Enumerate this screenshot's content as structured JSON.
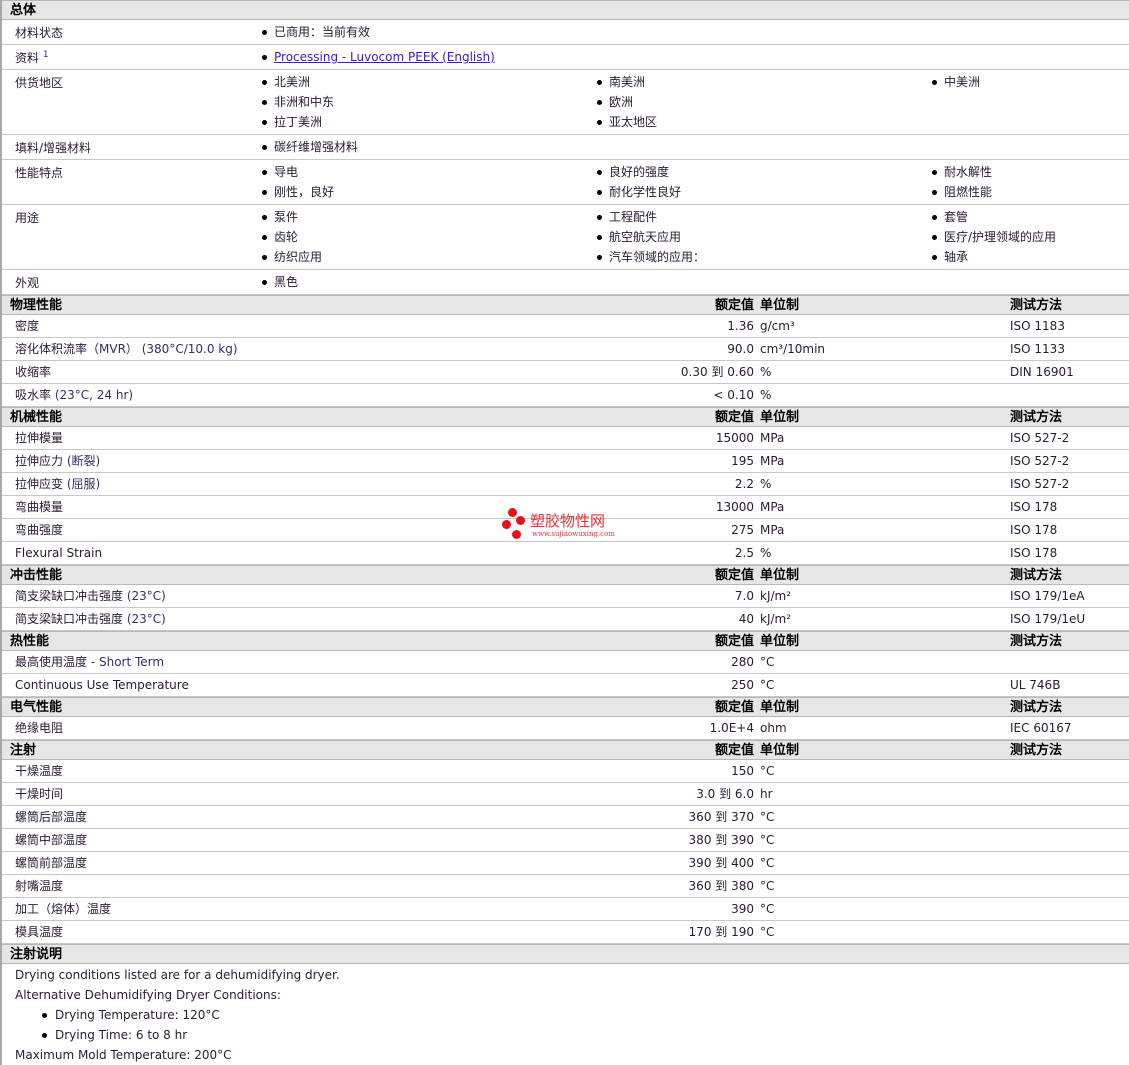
{
  "general": {
    "title": "总体",
    "rows": [
      {
        "label": "材料状态",
        "items": [
          "已商用：当前有效"
        ]
      },
      {
        "label": "资料",
        "sup": "1",
        "link": true,
        "items": [
          "Processing - Luvocom PEEK (English)"
        ]
      },
      {
        "label": "供货地区",
        "items": [
          "北美洲",
          "南美洲",
          "中美洲",
          "非洲和中东",
          "欧洲",
          "",
          "拉丁美洲",
          "亚太地区",
          ""
        ]
      },
      {
        "label": "填料/增强材料",
        "items": [
          "碳纤维增强材料"
        ]
      },
      {
        "label": "性能特点",
        "items": [
          "导电",
          "良好的强度",
          "耐水解性",
          "刚性，良好",
          "耐化学性良好",
          "阻燃性能"
        ]
      },
      {
        "label": "用途",
        "items": [
          "泵件",
          "工程配件",
          "套管",
          "齿轮",
          "航空航天应用",
          "医疗/护理领域的应用",
          "纺织应用",
          "汽车领域的应用：",
          "轴承"
        ]
      },
      {
        "label": "外观",
        "items": [
          "黑色"
        ]
      }
    ]
  },
  "headers": {
    "value": "额定值",
    "unit": "单位制",
    "method": "测试方法"
  },
  "sections": [
    {
      "title": "物理性能",
      "rows": [
        {
          "label": "密度",
          "value": "1.36",
          "unit": "g/cm³",
          "method": "ISO 1183"
        },
        {
          "label": "溶化体积流率（",
          "cond": "MVR）  (380°C/10.0 kg)",
          "value": "90.0",
          "unit": "cm³/10min",
          "method": "ISO 1133"
        },
        {
          "label": "收缩率",
          "value": "0.30 到  0.60",
          "unit": "%",
          "method": "DIN 16901"
        },
        {
          "label": "吸水率",
          "cond": " (23°C, 24 hr)",
          "value": "< 0.10",
          "unit": "%",
          "method": ""
        }
      ]
    },
    {
      "title": "机械性能",
      "rows": [
        {
          "label": "拉伸模量",
          "value": "15000",
          "unit": "MPa",
          "method": "ISO 527-2"
        },
        {
          "label": "拉伸应力",
          "cond": " (断裂)",
          "value": "195",
          "unit": "MPa",
          "method": "ISO 527-2"
        },
        {
          "label": "拉伸应变",
          "cond": " (屈服)",
          "value": "2.2",
          "unit": "%",
          "method": "ISO 527-2"
        },
        {
          "label": "弯曲模量",
          "value": "13000",
          "unit": "MPa",
          "method": "ISO 178"
        },
        {
          "label": "弯曲强度",
          "value": "275",
          "unit": "MPa",
          "method": "ISO 178"
        },
        {
          "label": "Flexural Strain",
          "value": "2.5",
          "unit": "%",
          "method": "ISO 178"
        }
      ]
    },
    {
      "title": "冲击性能",
      "rows": [
        {
          "label": "简支梁缺口冲击强度",
          "cond": " (23°C)",
          "value": "7.0",
          "unit": "kJ/m²",
          "method": "ISO 179/1eA"
        },
        {
          "label": "简支梁缺口冲击强度",
          "cond": " (23°C)",
          "value": "40",
          "unit": "kJ/m²",
          "method": "ISO 179/1eU"
        }
      ]
    },
    {
      "title": "热性能",
      "rows": [
        {
          "label": "最高使用温度",
          "cond": "  - Short Term",
          "value": "280",
          "unit": "°C",
          "method": ""
        },
        {
          "label": "Continuous Use Temperature",
          "value": "250",
          "unit": "°C",
          "method": "UL 746B"
        }
      ]
    },
    {
      "title": "电气性能",
      "rows": [
        {
          "label": "绝缘电阻",
          "value": "1.0E+4",
          "unit": "ohm",
          "method": "IEC 60167"
        }
      ]
    },
    {
      "title": "注射",
      "rows": [
        {
          "label": "干燥温度",
          "value": "150",
          "unit": "°C",
          "method": ""
        },
        {
          "label": "干燥时间",
          "value": "3.0 到  6.0",
          "unit": "hr",
          "method": ""
        },
        {
          "label": "螺筒后部温度",
          "value": "360 到  370",
          "unit": "°C",
          "method": ""
        },
        {
          "label": "螺筒中部温度",
          "value": "380 到  390",
          "unit": "°C",
          "method": ""
        },
        {
          "label": "螺筒前部温度",
          "value": "390 到  400",
          "unit": "°C",
          "method": ""
        },
        {
          "label": "射嘴温度",
          "value": "360 到  380",
          "unit": "°C",
          "method": ""
        },
        {
          "label": "加工（熔体）温度",
          "value": "390",
          "unit": "°C",
          "method": ""
        },
        {
          "label": "模具温度",
          "value": "170 到  190",
          "unit": "°C",
          "method": ""
        }
      ]
    }
  ],
  "notes": {
    "title": "注射说明",
    "lines": [
      {
        "text": "Drying conditions listed are for a dehumidifying dryer."
      },
      {
        "text": "Alternative Dehumidifying Dryer Conditions:"
      },
      {
        "text": "Drying Temperature: 120°C",
        "bullet": true
      },
      {
        "text": "Drying Time: 6 to 8 hr",
        "bullet": true
      },
      {
        "text": "Maximum Mold Temperature: 200°C"
      }
    ]
  },
  "watermark": {
    "name": "塑胶物性网",
    "url": "www.sujiaowuxing.com"
  }
}
